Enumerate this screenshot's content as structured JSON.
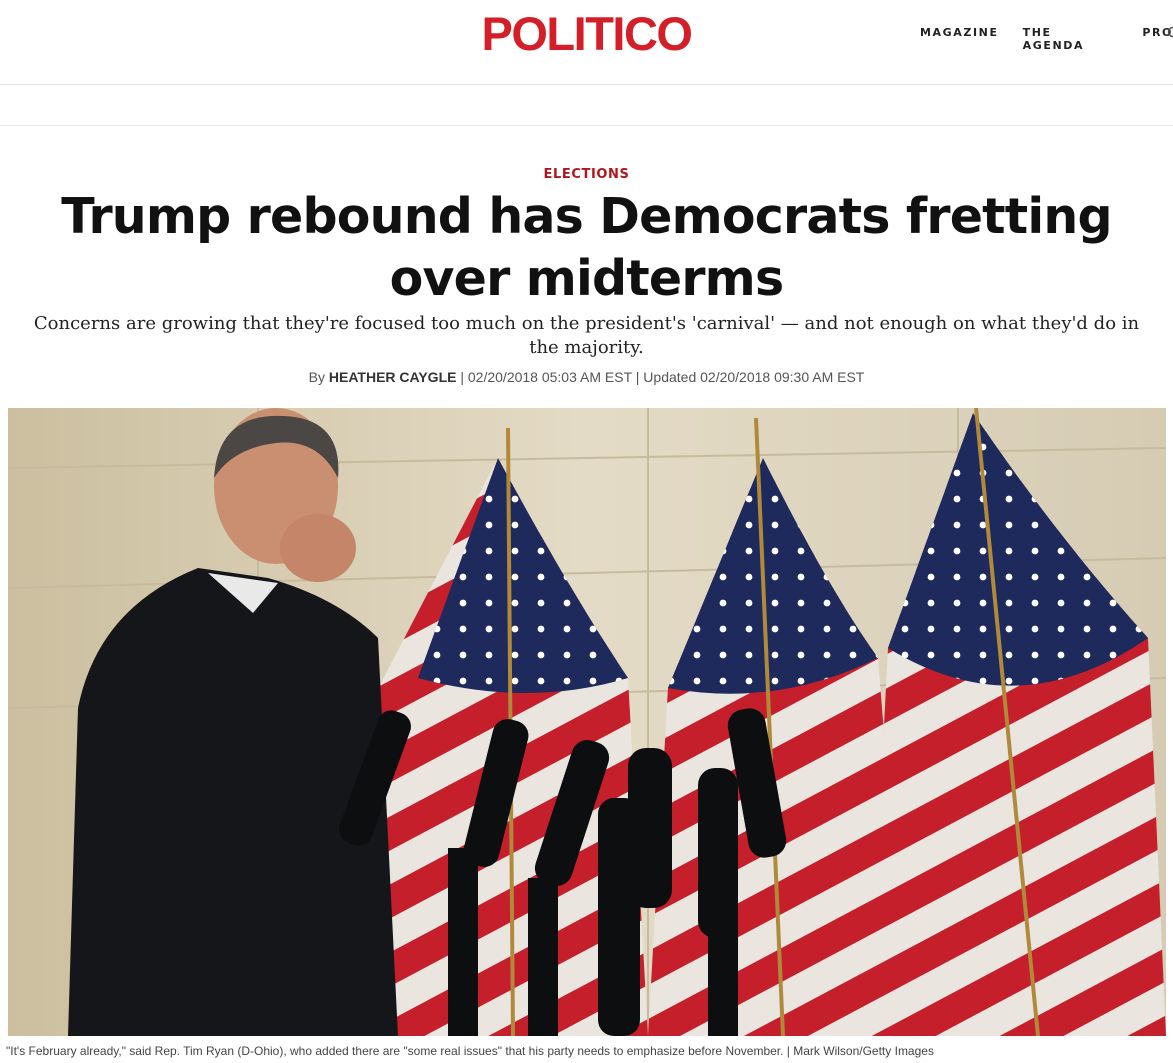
{
  "header": {
    "logo": "POLITICO",
    "nav": [
      "MAGAZINE",
      "THE AGENDA",
      "PRO"
    ],
    "search_icon": "search-icon",
    "brand_color": "#d41f29"
  },
  "article": {
    "section": "ELECTIONS",
    "headline": "Trump rebound has Democrats fretting over midterms",
    "dek": "Concerns are growing that they're focused too much on the president's 'carnival' — and not enough on what they'd do in the majority.",
    "byline": {
      "prefix": "By",
      "author": "HEATHER CAYGLE",
      "sep1": " | ",
      "published": "02/20/2018 05:03 AM EST",
      "sep2": " | ",
      "updated": "Updated 02/20/2018 09:30 AM EST"
    },
    "caption": "\"It's February already,\" said Rep. Tim Ryan (D-Ohio), who added there are \"some real issues\" that his party needs to emphasize before November. | Mark Wilson/Getty Images"
  }
}
